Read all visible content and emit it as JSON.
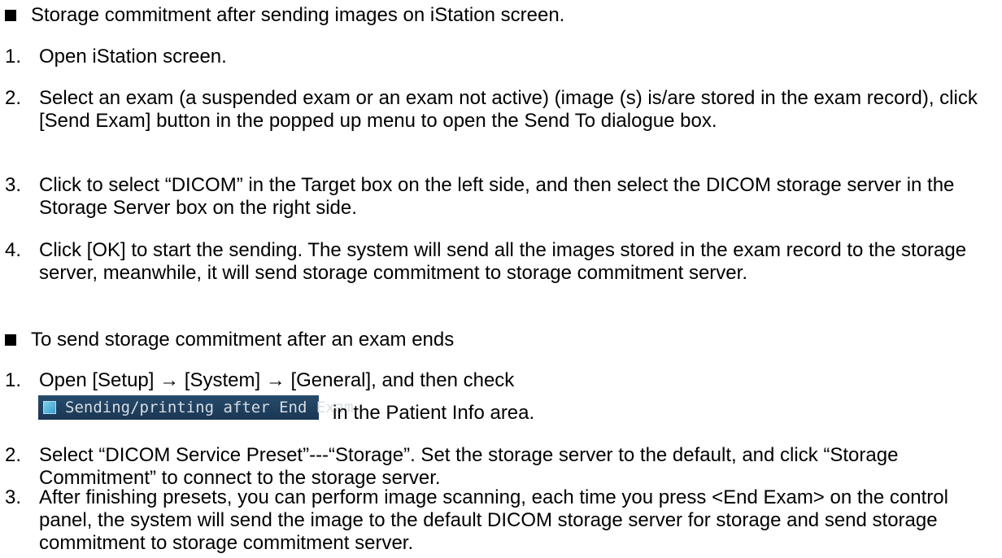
{
  "section1": {
    "heading": "Storage commitment after sending images on iStation screen.",
    "steps": [
      {
        "num": "1.",
        "text": "Open iStation screen."
      },
      {
        "num": "2.",
        "text": "Select an exam (a suspended exam or an exam not active) (image (s) is/are stored in the exam record), click [Send Exam] button in the popped up menu to open the Send To dialogue box."
      },
      {
        "num": "3.",
        "text": "Click to select “DICOM” in the Target box on the left side, and then select the DICOM storage server in the Storage Server box on the right side."
      },
      {
        "num": "4.",
        "text": "Click [OK] to start the sending. The system will send all the images stored in the exam record to the storage server, meanwhile, it will send storage commitment to storage commitment server."
      }
    ]
  },
  "section2": {
    "heading": "To send storage commitment after an exam ends",
    "step1": {
      "num": "1.",
      "text": "Open [Setup] → [System] → [General], and then check"
    },
    "setting_label": "Sending/printing after End Exam",
    "setting_suffix": "in the Patient Info area.",
    "steps": [
      {
        "num": "2.",
        "text": "Select “DICOM Service Preset”---“Storage”. Set the storage server to the default, and click “Storage Commitment” to connect to the storage server."
      },
      {
        "num": "3.",
        "text": "After finishing presets, you can perform image scanning, each time you press <End Exam> on the control panel, the system will send the image to the default DICOM storage server for storage and send storage commitment to storage commitment server."
      }
    ]
  }
}
